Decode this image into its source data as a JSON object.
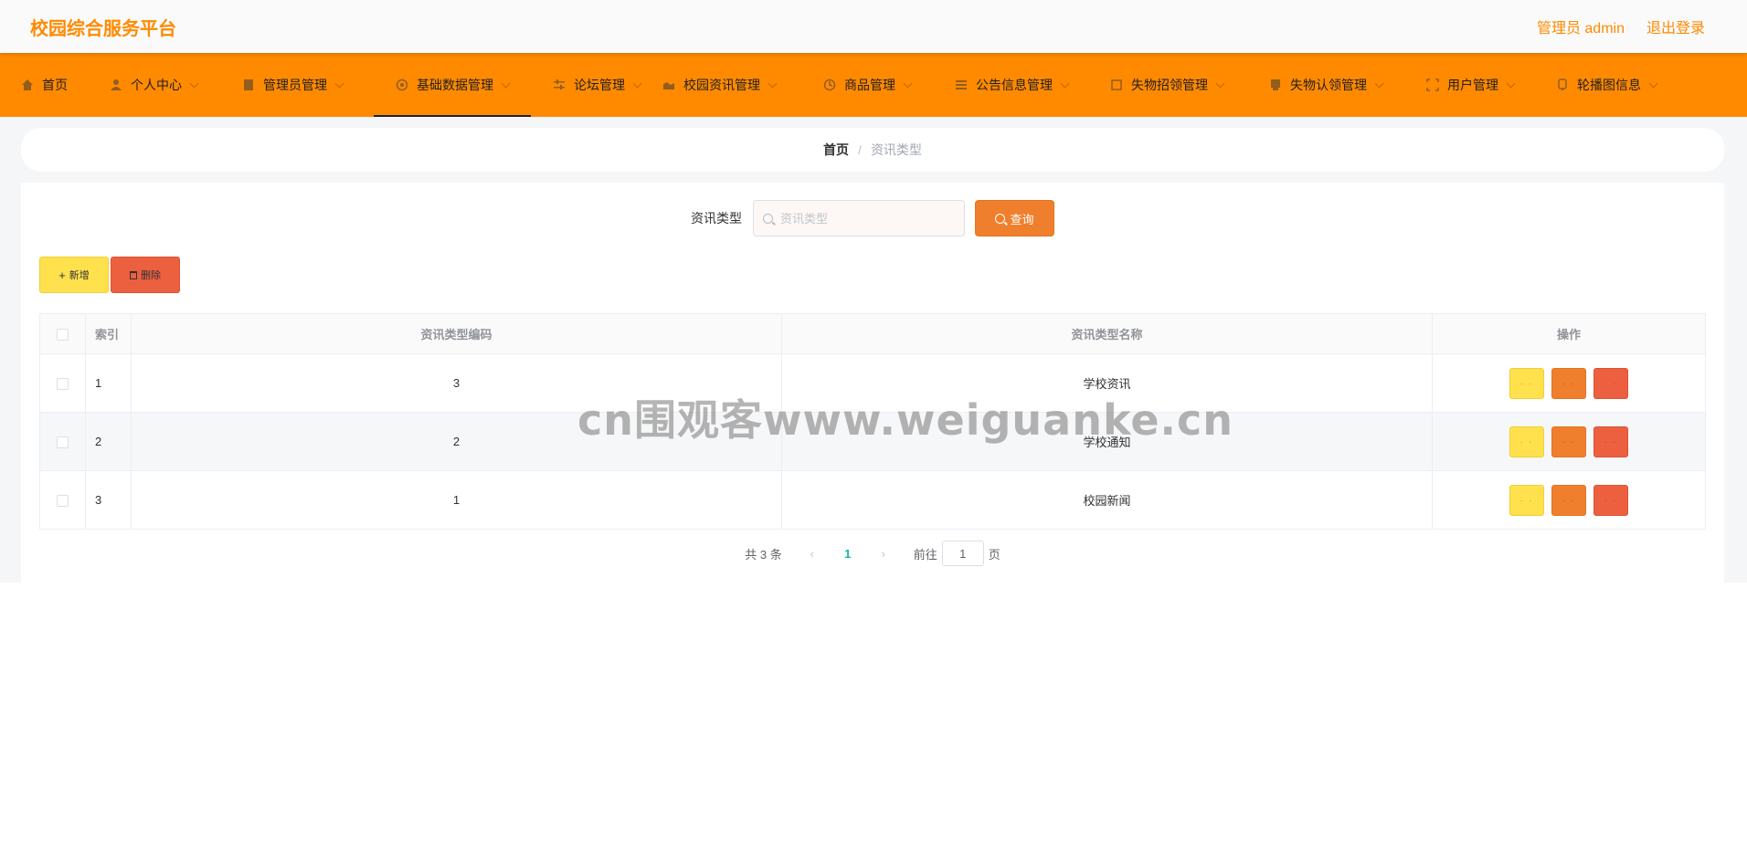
{
  "header": {
    "title": "校园综合服务平台",
    "user_label": "管理员 admin",
    "logout_label": "退出登录"
  },
  "nav": {
    "items": [
      {
        "label": "首页",
        "icon": "home-icon"
      },
      {
        "label": "个人中心",
        "icon": "user-icon"
      },
      {
        "label": "管理员管理",
        "icon": "document-icon"
      },
      {
        "label": "基础数据管理",
        "icon": "settings-icon"
      },
      {
        "label": "论坛管理",
        "icon": "sliders-icon"
      },
      {
        "label": "校园资讯管理",
        "icon": "news-icon"
      },
      {
        "label": "商品管理",
        "icon": "clock-icon"
      },
      {
        "label": "公告信息管理",
        "icon": "list-icon"
      },
      {
        "label": "失物招领管理",
        "icon": "frame-icon"
      },
      {
        "label": "失物认领管理",
        "icon": "box-icon"
      },
      {
        "label": "用户管理",
        "icon": "users-icon"
      },
      {
        "label": "轮播图信息",
        "icon": "image-icon"
      }
    ],
    "active_index": 3
  },
  "breadcrumb": {
    "home": "首页",
    "separator": "/",
    "current": "资讯类型"
  },
  "search": {
    "label": "资讯类型",
    "placeholder": "资讯类型",
    "value": "",
    "button_label": "查询"
  },
  "actions": {
    "add_label": "新增",
    "delete_label": "删除"
  },
  "table": {
    "columns": [
      "索引",
      "资讯类型编码",
      "资讯类型名称",
      "操作"
    ],
    "rows": [
      {
        "index": "1",
        "code": "3",
        "name": "学校资讯"
      },
      {
        "index": "2",
        "code": "2",
        "name": "学校通知"
      },
      {
        "index": "3",
        "code": "1",
        "name": "校园新闻"
      }
    ]
  },
  "pagination": {
    "total_text": "共 3 条",
    "current_page": "1",
    "goto_label": "前往",
    "goto_value": "1",
    "page_suffix": "页"
  },
  "watermark": "cn围观客www.weiguanke.cn",
  "colors": {
    "brand": "#ff8a00",
    "add": "#ffe14d",
    "edit": "#ef7f2c",
    "delete": "#ec6040",
    "pagination_active": "#14b8a6"
  }
}
